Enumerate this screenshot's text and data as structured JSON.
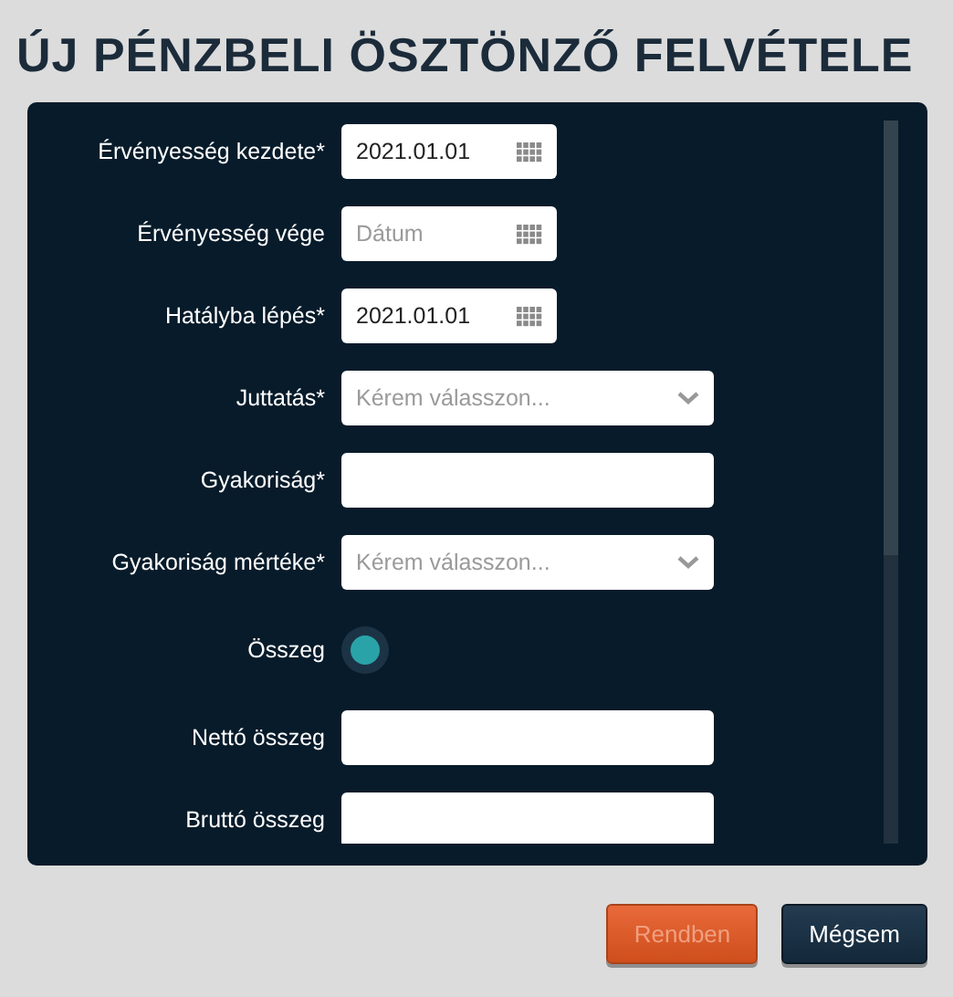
{
  "title": "ÚJ PÉNZBELI ÖSZTÖNZŐ FELVÉTELE",
  "fields": [
    {
      "kind": "date",
      "label": "Érvényesség kezdete*",
      "value": "2021.01.01"
    },
    {
      "kind": "date",
      "label": "Érvényesség vége",
      "placeholder": "Dátum"
    },
    {
      "kind": "date",
      "label": "Hatályba lépés*",
      "value": "2021.01.01"
    },
    {
      "kind": "select",
      "label": "Juttatás*",
      "placeholder": "Kérem válasszon..."
    },
    {
      "kind": "text",
      "label": "Gyakoriság*"
    },
    {
      "kind": "select",
      "label": "Gyakoriság mértéke*",
      "placeholder": "Kérem válasszon..."
    },
    {
      "kind": "toggle",
      "label": "Összeg",
      "on": true
    },
    {
      "kind": "text",
      "label": "Nettó összeg"
    },
    {
      "kind": "text",
      "label": "Bruttó összeg"
    }
  ],
  "buttons": [
    {
      "label": "Rendben",
      "kind": "primary",
      "disabled": true
    },
    {
      "label": "Mégsem",
      "kind": "secondary",
      "disabled": false
    }
  ]
}
